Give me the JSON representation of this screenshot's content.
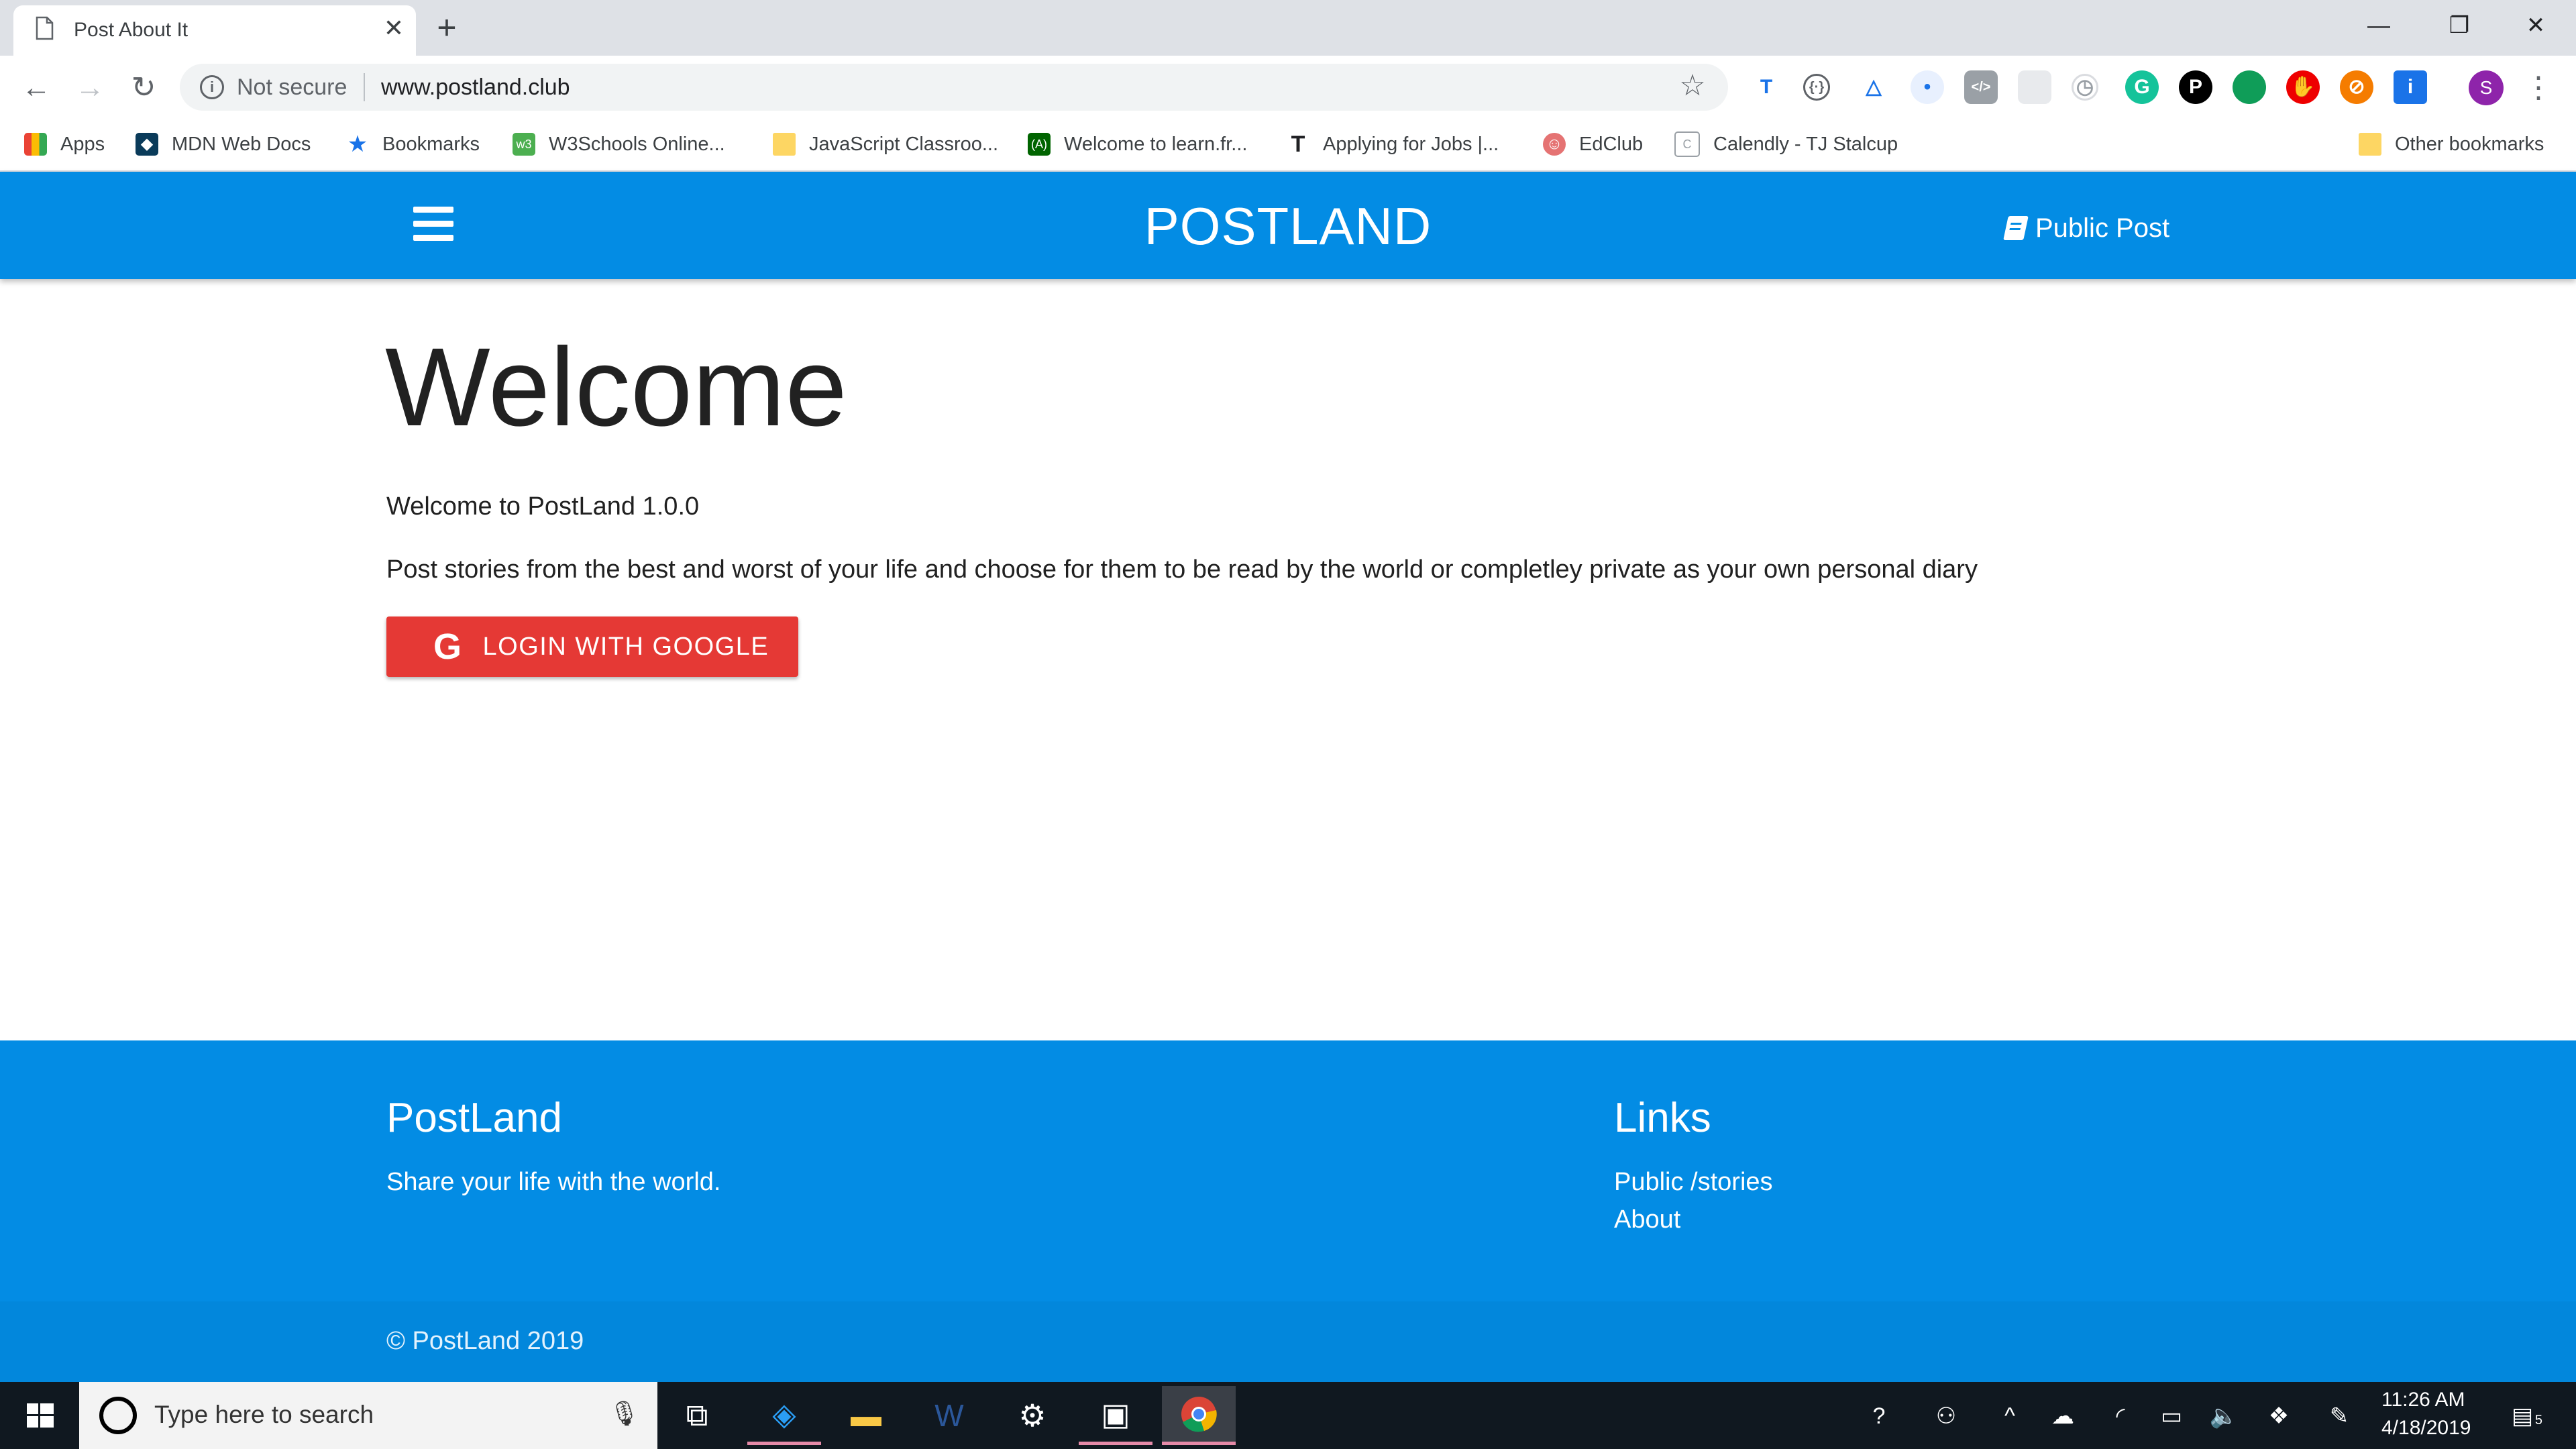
{
  "browser": {
    "tab_title": "Post About It",
    "tab_close": "✕",
    "new_tab": "+",
    "window_minimize": "—",
    "window_restore": "❐",
    "window_close": "✕",
    "security_label": "Not secure",
    "url": "www.postland.club",
    "profile_initial": "S",
    "bookmarks": [
      {
        "label": "Apps",
        "icon": "apps-grid-icon"
      },
      {
        "label": "MDN Web Docs",
        "icon": "mdn-icon"
      },
      {
        "label": "Bookmarks",
        "icon": "star-icon"
      },
      {
        "label": "W3Schools Online...",
        "icon": "w3schools-icon"
      },
      {
        "label": "JavaScript Classroo...",
        "icon": "folder-icon"
      },
      {
        "label": "Welcome to learn.fr...",
        "icon": "freecodecamp-icon"
      },
      {
        "label": "Applying for Jobs |...",
        "icon": "t-logo-icon"
      },
      {
        "label": "EdClub",
        "icon": "edclub-icon"
      },
      {
        "label": "Calendly - TJ Stalcup",
        "icon": "calendly-icon"
      }
    ],
    "other_bookmarks": "Other bookmarks"
  },
  "header": {
    "brand": "POSTLAND",
    "public_post": "Public Post"
  },
  "main": {
    "title": "Welcome",
    "version_text": "Welcome to PostLand 1.0.0",
    "description": "Post stories from the best and worst of your life and choose for them to be read by the world or completley private as your own personal diary",
    "login_button": "LOGIN WITH GOOGLE",
    "google_glyph": "G"
  },
  "footer": {
    "brand": "PostLand",
    "tagline": "Share your life with the world.",
    "links_heading": "Links",
    "links": [
      "Public /stories",
      "About"
    ],
    "copyright": "© PostLand 2019"
  },
  "taskbar": {
    "search_placeholder": "Type here to search",
    "time": "11:26 AM",
    "date": "4/18/2019",
    "notification_count": "5"
  },
  "colors": {
    "brand_blue": "#038ce4",
    "login_red": "#e53935"
  }
}
